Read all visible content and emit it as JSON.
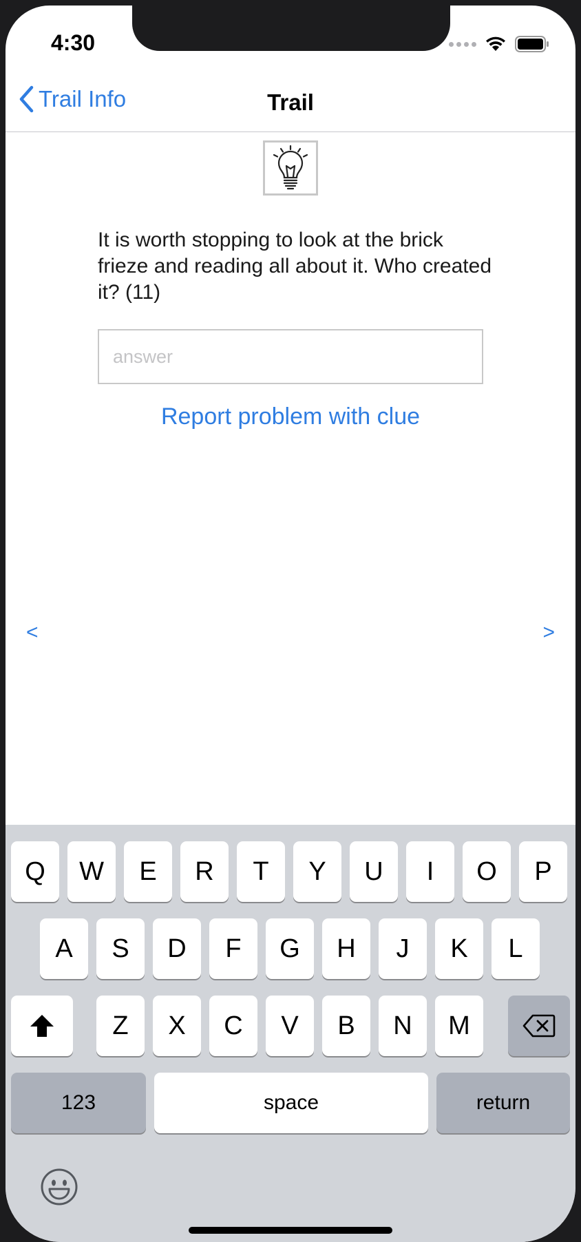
{
  "status": {
    "time": "4:30"
  },
  "nav": {
    "back_label": "Trail Info",
    "title": "Trail"
  },
  "clue": {
    "icon": "lightbulb-icon",
    "text": "It is worth stopping to look at the brick frieze and reading all about it. Who created it? (11)",
    "answer_value": "",
    "answer_placeholder": "answer",
    "report_link": "Report problem with clue"
  },
  "pager": {
    "prev": "<",
    "next": ">"
  },
  "keyboard": {
    "row1": [
      "Q",
      "W",
      "E",
      "R",
      "T",
      "Y",
      "U",
      "I",
      "O",
      "P"
    ],
    "row2": [
      "A",
      "S",
      "D",
      "F",
      "G",
      "H",
      "J",
      "K",
      "L"
    ],
    "row3": [
      "Z",
      "X",
      "C",
      "V",
      "B",
      "N",
      "M"
    ],
    "numbers_label": "123",
    "space_label": "space",
    "return_label": "return"
  },
  "colors": {
    "accent": "#2f7de1",
    "keyboard_bg": "#d1d4d9",
    "key_dark": "#abb0ba"
  }
}
